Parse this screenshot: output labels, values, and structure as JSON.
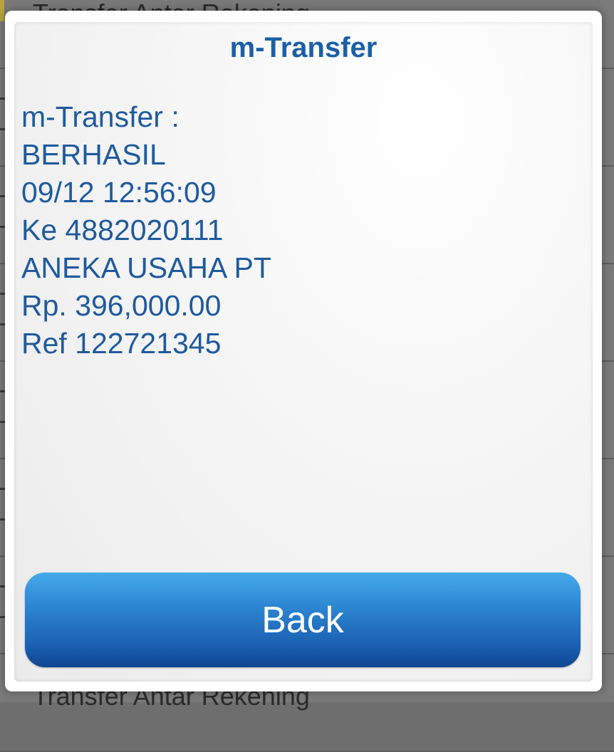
{
  "background": {
    "rows": [
      {
        "label": "Transfer Antar Rekening"
      },
      {
        "label": ""
      },
      {
        "label": ""
      },
      {
        "label": ""
      },
      {
        "label": ""
      },
      {
        "label": ""
      },
      {
        "label": ""
      },
      {
        "label": "Transfer Antar Rekening"
      }
    ]
  },
  "dialog": {
    "title": "m-Transfer",
    "message_lines": [
      "m-Transfer :",
      "BERHASIL",
      "09/12 12:56:09",
      "Ke 4882020111",
      "ANEKA USAHA PT",
      "Rp. 396,000.00",
      "Ref 122721345"
    ],
    "back_label": "Back"
  },
  "colors": {
    "title": "#1b5fa6",
    "message_text": "#1f5a9e",
    "button_top": "#45aaea",
    "button_bottom": "#0e4591"
  }
}
